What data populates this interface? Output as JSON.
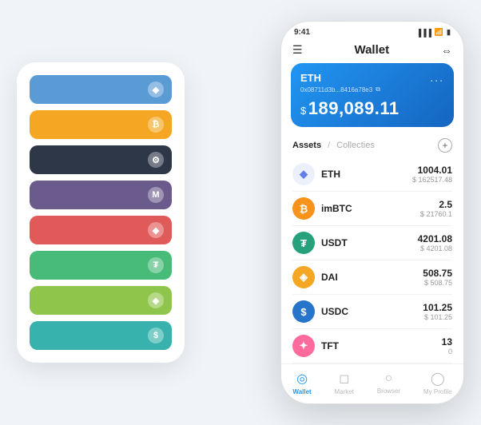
{
  "app": {
    "title": "Wallet",
    "statusBar": {
      "time": "9:41",
      "signal": "▐▐▐",
      "wifi": "WiFi",
      "battery": "🔋"
    }
  },
  "header": {
    "title": "Wallet",
    "menu_label": "Menu",
    "scan_label": "Scan"
  },
  "ethCard": {
    "label": "ETH",
    "address": "0x08711d3b...8416a78e3",
    "copy_icon": "⧉",
    "more": "...",
    "balance_prefix": "$",
    "balance": "189,089.11"
  },
  "assets": {
    "tab_active": "Assets",
    "divider": "/",
    "tab_inactive": "Collecties",
    "add": "+"
  },
  "assetList": [
    {
      "symbol": "ETH",
      "name": "ETH",
      "amount": "1004.01",
      "usd": "$ 162517.48",
      "color": "#ecf0fb",
      "text_color": "#627eea",
      "icon": "◆"
    },
    {
      "symbol": "imBTC",
      "name": "imBTC",
      "amount": "2.5",
      "usd": "$ 21760.1",
      "color": "#f7931a",
      "text_color": "#fff",
      "icon": "₿"
    },
    {
      "symbol": "USDT",
      "name": "USDT",
      "amount": "4201.08",
      "usd": "$ 4201.08",
      "color": "#26a17b",
      "text_color": "#fff",
      "icon": "₮"
    },
    {
      "symbol": "DAI",
      "name": "DAI",
      "amount": "508.75",
      "usd": "$ 508.75",
      "color": "#f5a623",
      "text_color": "#fff",
      "icon": "◈"
    },
    {
      "symbol": "USDC",
      "name": "USDC",
      "amount": "101.25",
      "usd": "$ 101.25",
      "color": "#2775ca",
      "text_color": "#fff",
      "icon": "$"
    },
    {
      "symbol": "TFT",
      "name": "TFT",
      "amount": "13",
      "usd": "0",
      "color": "#ff6b9d",
      "text_color": "#fff",
      "icon": "✦"
    }
  ],
  "bottomNav": [
    {
      "label": "Wallet",
      "active": true,
      "icon": "◎"
    },
    {
      "label": "Market",
      "active": false,
      "icon": "📈"
    },
    {
      "label": "Browser",
      "active": false,
      "icon": "👤"
    },
    {
      "label": "My Profile",
      "active": false,
      "icon": "👤"
    }
  ],
  "cardStack": [
    {
      "color": "#5b9bd5",
      "icon": "◆"
    },
    {
      "color": "#f5a623",
      "icon": "₿"
    },
    {
      "color": "#2d3748",
      "icon": "⚙"
    },
    {
      "color": "#6b5b8c",
      "icon": "M"
    },
    {
      "color": "#e05a5a",
      "icon": "◆"
    },
    {
      "color": "#48bb78",
      "icon": "₮"
    },
    {
      "color": "#8fc54b",
      "icon": "◈"
    },
    {
      "color": "#38b2ac",
      "icon": "$"
    }
  ]
}
